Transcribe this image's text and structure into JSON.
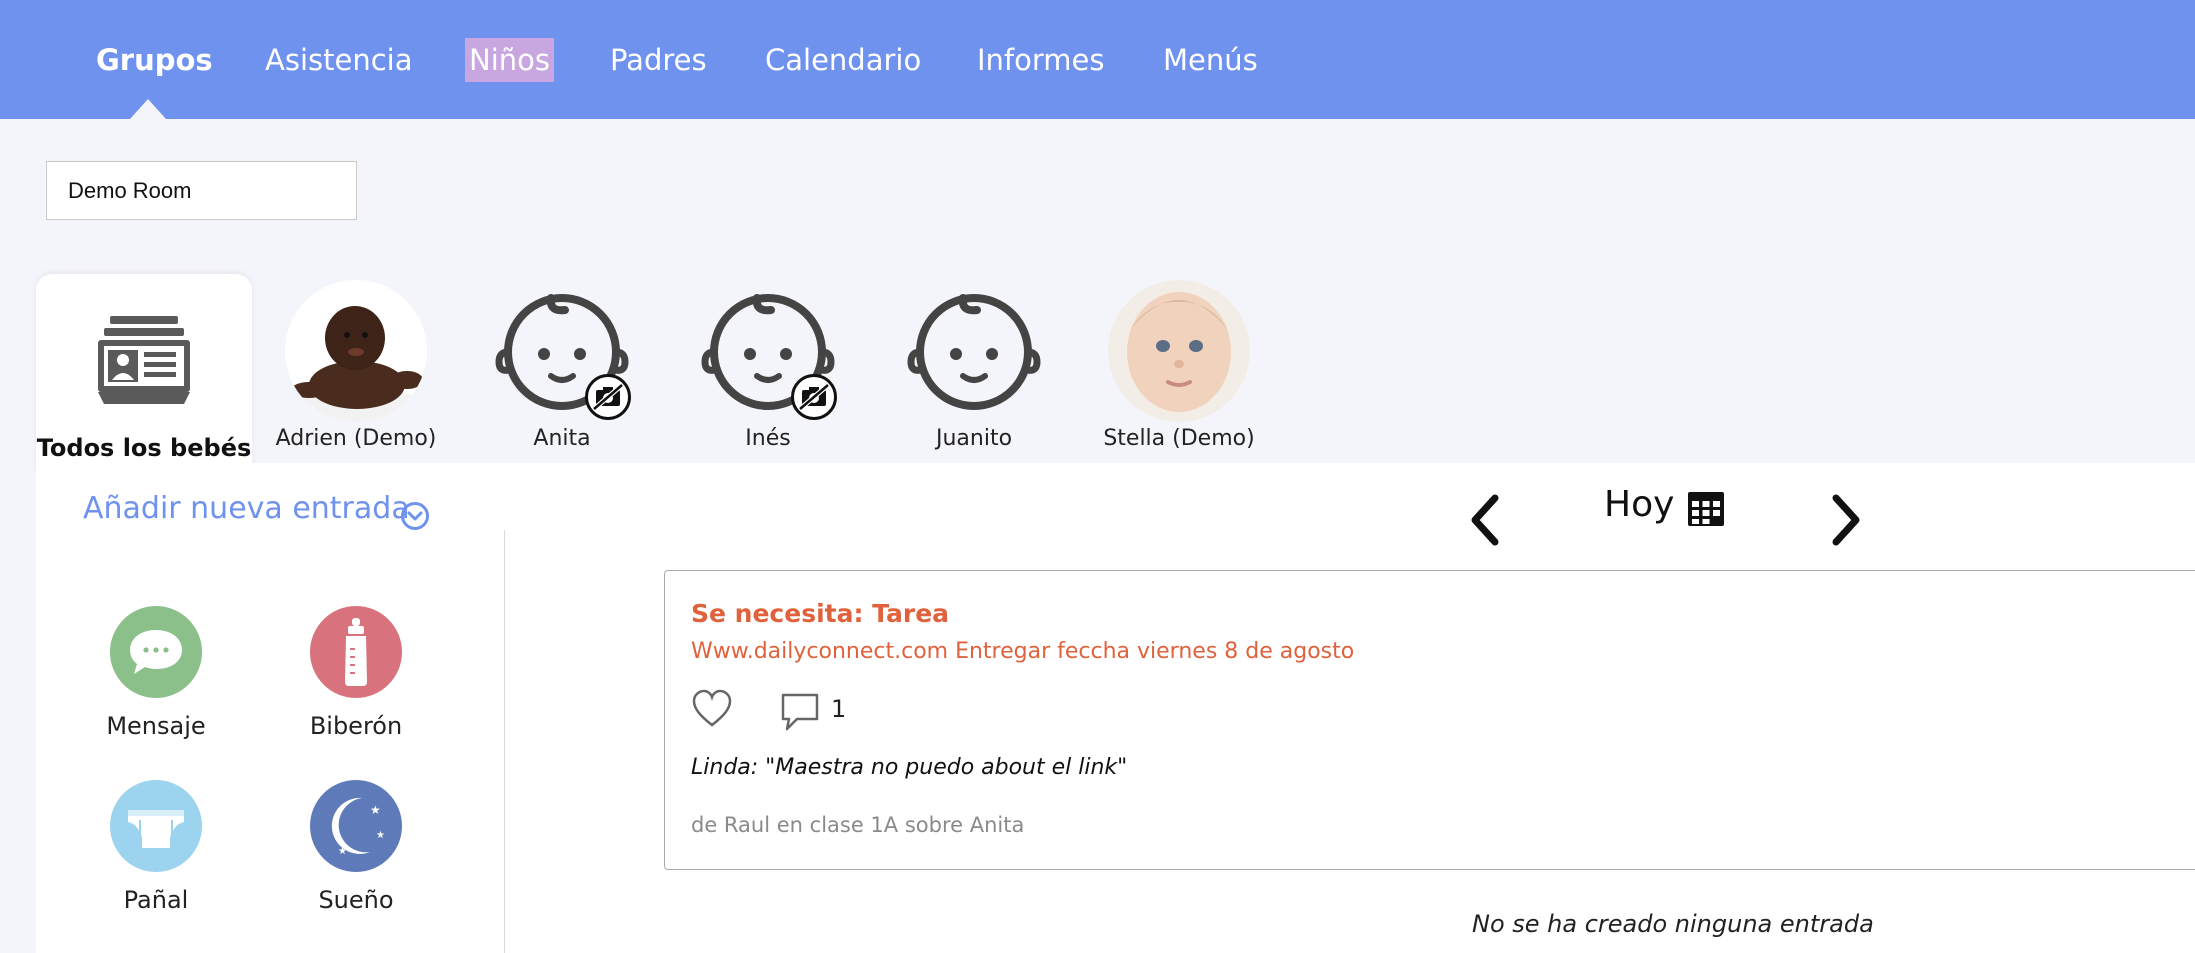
{
  "nav": {
    "tabs": [
      {
        "label": "Grupos",
        "active": true
      },
      {
        "label": "Asistencia"
      },
      {
        "label": "Niños",
        "highlighted": true
      },
      {
        "label": "Padres"
      },
      {
        "label": "Calendario"
      },
      {
        "label": "Informes"
      },
      {
        "label": "Menús"
      }
    ]
  },
  "room": {
    "selected": "Demo Room"
  },
  "children": {
    "all_label": "Todos los bebés",
    "items": [
      {
        "name": "Adrien (Demo)",
        "avatar": "photo"
      },
      {
        "name": "Anita",
        "avatar": "baby-face-icon",
        "no_photo_badge": true
      },
      {
        "name": "Inés",
        "avatar": "baby-face-icon",
        "no_photo_badge": true
      },
      {
        "name": "Juanito",
        "avatar": "baby-face-icon"
      },
      {
        "name": "Stella (Demo)",
        "avatar": "photo"
      }
    ]
  },
  "entries": {
    "add_label": "Añadir nueva entrada",
    "types": [
      {
        "label": "Mensaje",
        "icon": "message-icon",
        "color": "#8cc08a"
      },
      {
        "label": "Biberón",
        "icon": "bottle-icon",
        "color": "#d8727c"
      },
      {
        "label": "Pañal",
        "icon": "diaper-icon",
        "color": "#9cd3ef"
      },
      {
        "label": "Sueño",
        "icon": "moon-icon",
        "color": "#5f7ab8"
      }
    ]
  },
  "date_nav": {
    "label": "Hoy"
  },
  "feed": {
    "card": {
      "title": "Se necesita: Tarea",
      "description": "Www.dailyconnect.com Entregar feccha viernes 8 de agosto",
      "comment_count": "1",
      "comment": "Linda: \"Maestra no puedo about el link\"",
      "meta": "de Raul en clase 1A sobre Anita"
    },
    "empty_message": "No se ha creado ninguna entrada"
  },
  "colors": {
    "nav_bg": "#6f92ef",
    "accent_text": "#e0623c",
    "link": "#6f92ef"
  }
}
